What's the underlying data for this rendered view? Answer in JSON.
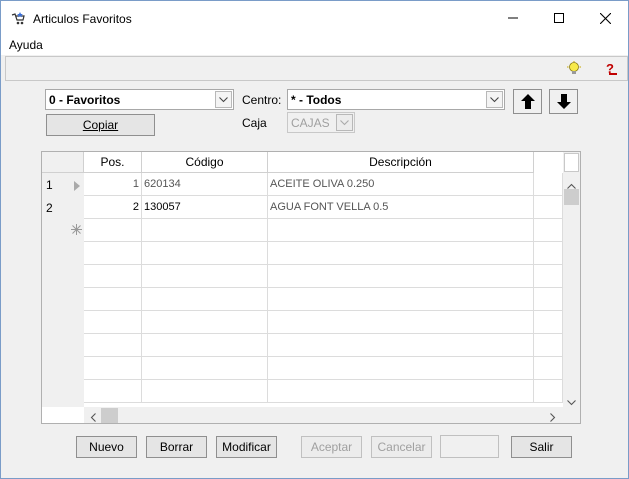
{
  "window": {
    "title": "Articulos Favoritos"
  },
  "menu": {
    "items": [
      "Ayuda"
    ]
  },
  "toolbar": {
    "icons": [
      "lightbulb-icon",
      "help-icon"
    ]
  },
  "filters": {
    "favoritos_value": "0 - Favoritos",
    "copiar_label": "Copiar",
    "centro_label": "Centro:",
    "centro_value": "* - Todos",
    "caja_label": "Caja",
    "caja_value": "CAJAS"
  },
  "grid": {
    "columns": [
      "Pos.",
      "Código",
      "Descripción"
    ],
    "rows": [
      {
        "index": "1",
        "pos": "1",
        "codigo": "620134",
        "descripcion": "ACEITE OLIVA 0.250"
      },
      {
        "index": "2",
        "pos": "2",
        "codigo": "130057",
        "descripcion": "AGUA FONT VELLA 0.5"
      }
    ]
  },
  "buttons": {
    "nuevo": "Nuevo",
    "borrar": "Borrar",
    "modificar": "Modificar",
    "aceptar": "Aceptar",
    "cancelar": "Cancelar",
    "salir": "Salir"
  }
}
